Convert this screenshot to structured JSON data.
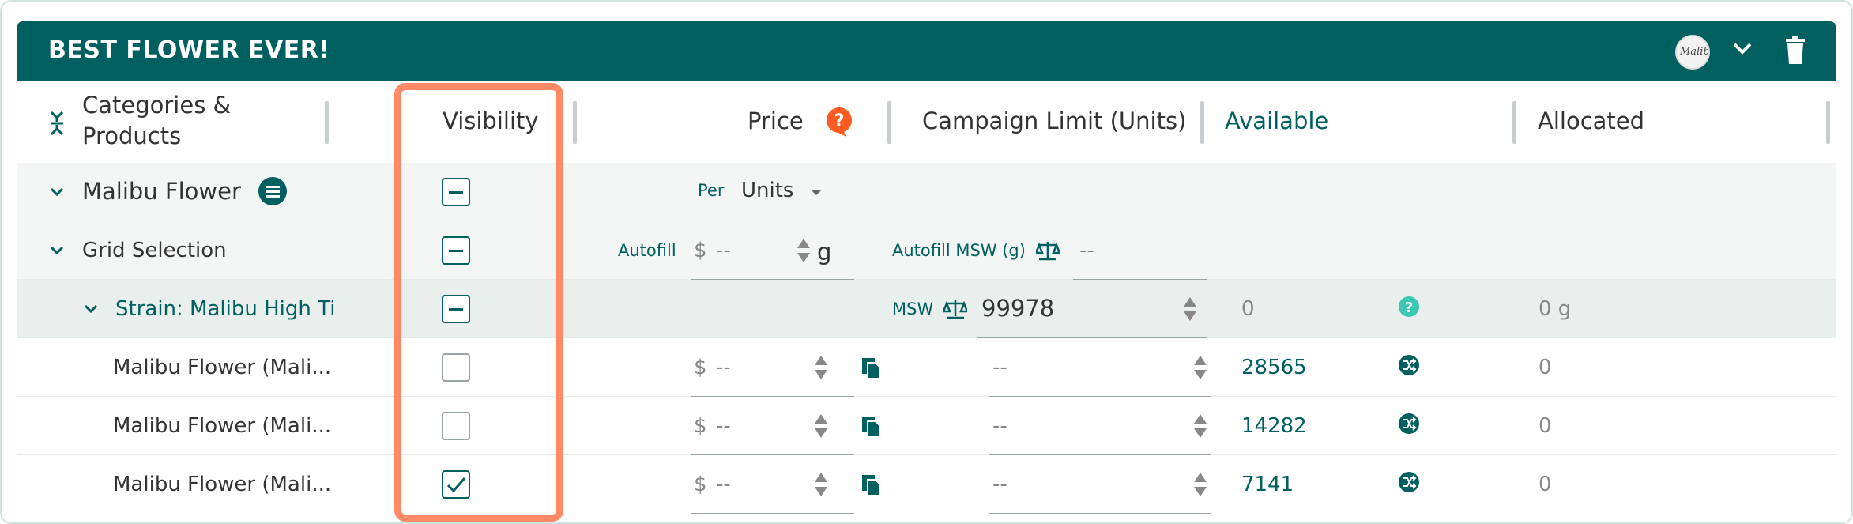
{
  "header": {
    "title": "BEST FLOWER EVER!",
    "avatar_text": "Malibu"
  },
  "columns": {
    "categories": "Categories &",
    "products": "Products",
    "visibility": "Visibility",
    "price": "Price",
    "campaign_limit": "Campaign Limit (Units)",
    "available": "Available",
    "allocated": "Allocated"
  },
  "rows": {
    "brand": {
      "name": "Malibu Flower",
      "per_label": "Per",
      "unit_value": "Units"
    },
    "grid": {
      "name": "Grid Selection",
      "autofill_label": "Autofill",
      "currency": "$",
      "price_value": "--",
      "unit": "g",
      "autofill_msw_label": "Autofill MSW (g)",
      "msw_value": "--"
    },
    "strain": {
      "name": "Strain: Malibu High Ti",
      "msw_label": "MSW",
      "msw_value": "99978",
      "available": "0",
      "allocated": "0 g"
    },
    "products": [
      {
        "name": "Malibu Flower (Mali...",
        "currency": "$",
        "price": "--",
        "limit": "--",
        "available": "28565",
        "allocated": "0",
        "checked": false
      },
      {
        "name": "Malibu Flower (Mali...",
        "currency": "$",
        "price": "--",
        "limit": "--",
        "available": "14282",
        "allocated": "0",
        "checked": false
      },
      {
        "name": "Malibu Flower (Mali...",
        "currency": "$",
        "price": "--",
        "limit": "--",
        "available": "7141",
        "allocated": "0",
        "checked": true
      }
    ]
  },
  "colors": {
    "primary": "#005f5f",
    "highlight": "#ff8a65",
    "help": "#ff5a1f",
    "help_teal": "#3cc7b0"
  }
}
